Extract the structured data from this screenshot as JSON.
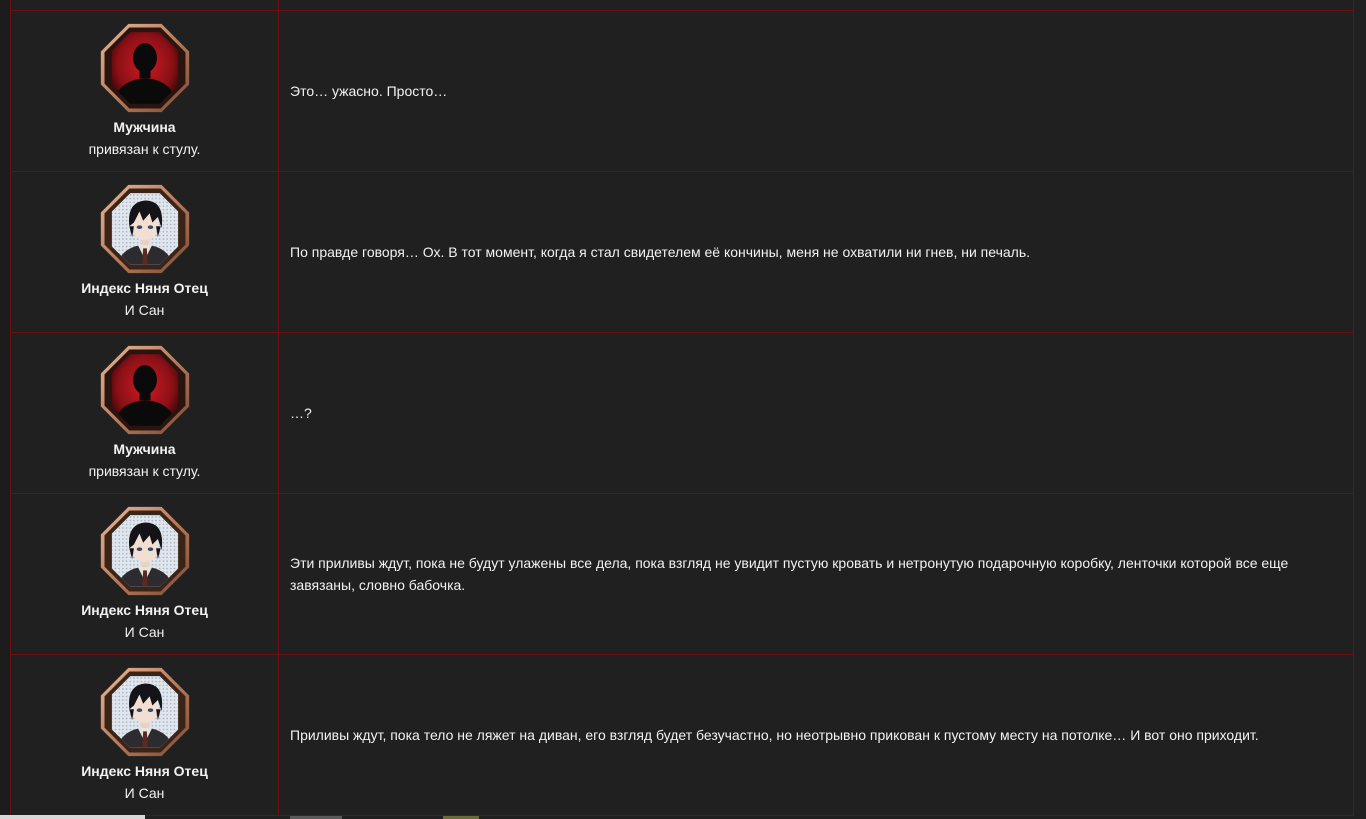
{
  "colors": {
    "background": "#202020",
    "border": "#6b0f12",
    "text": "#f2f2f2",
    "avatar_frame": "#c89070",
    "silhouette_bg": "#8a1016"
  },
  "rows": [
    {
      "speaker": "Мужчина",
      "subtitle": "привязан к стулу.",
      "avatar": "silhouette-icon",
      "text": "Это… ужасно. Просто…"
    },
    {
      "speaker": "Индекс Няня Отец",
      "subtitle": "И Сан",
      "avatar": "character-portrait-icon",
      "text": "По правде говоря… Ох. В тот момент, когда я стал свидетелем её кончины, меня не охватили ни гнев, ни печаль."
    },
    {
      "speaker": "Мужчина",
      "subtitle": "привязан к стулу.",
      "avatar": "silhouette-icon",
      "text": "…?"
    },
    {
      "speaker": "Индекс Няня Отец",
      "subtitle": "И Сан",
      "avatar": "character-portrait-icon",
      "text": "Эти приливы ждут, пока не будут улажены все дела, пока взгляд не увидит пустую кровать и нетронутую подарочную коробку, ленточки которой все еще завязаны, словно бабочка."
    },
    {
      "speaker": "Индекс Няня Отец",
      "subtitle": "И Сан",
      "avatar": "character-portrait-icon",
      "text": "Приливы ждут, пока тело не ляжет на диван, его взгляд будет безучастно, но неотрывно прикован к пустому месту на потолке… И вот оно приходит."
    }
  ]
}
